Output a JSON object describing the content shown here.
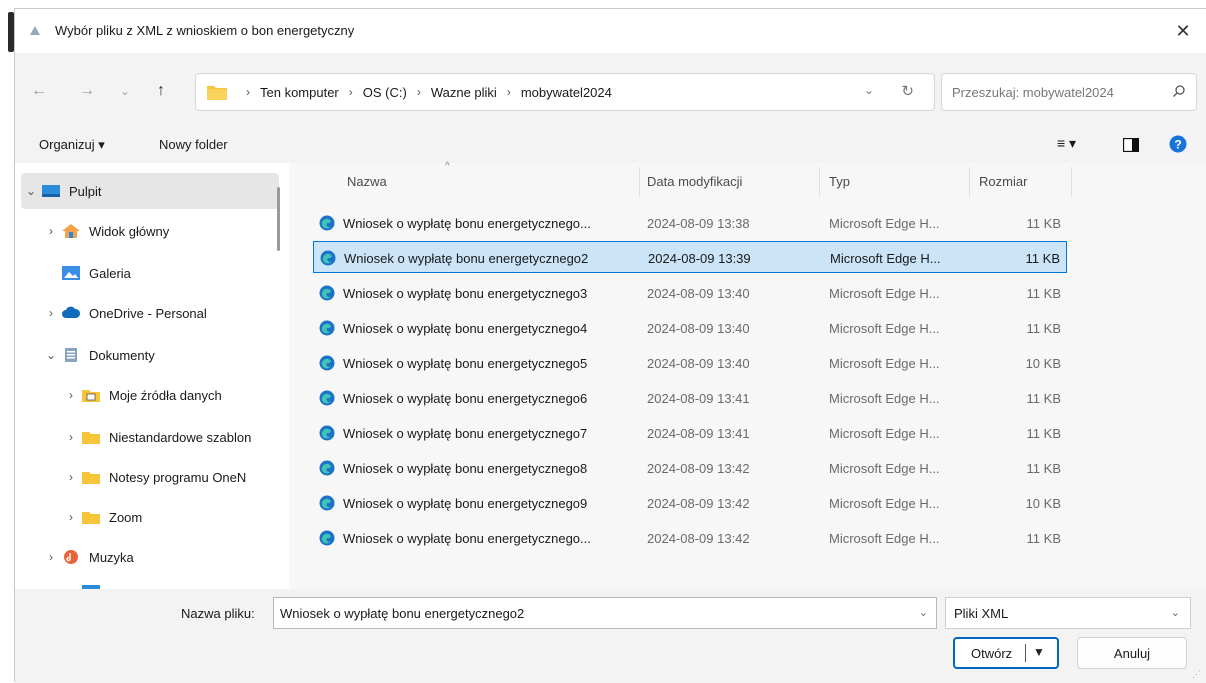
{
  "window": {
    "title": "Wybór pliku z XML z wnioskiem o bon energetyczny"
  },
  "address": {
    "crumbs": [
      "Ten komputer",
      "OS (C:)",
      "Wazne pliki",
      "mobywatel2024"
    ]
  },
  "search": {
    "placeholder": "Przeszukaj: mobywatel2024"
  },
  "toolbar": {
    "organize": "Organizuj ▾",
    "new_folder": "Nowy folder"
  },
  "sidebar": {
    "items": [
      {
        "label": "Pulpit",
        "icon": "desktop-icon",
        "chevron": "v",
        "selected": true
      },
      {
        "label": "Widok główny",
        "icon": "home-icon",
        "chevron": ">"
      },
      {
        "label": "Galeria",
        "icon": "gallery-icon",
        "chevron": ""
      },
      {
        "label": "OneDrive - Personal",
        "icon": "cloud-icon",
        "chevron": ">"
      },
      {
        "label": "Dokumenty",
        "icon": "documents-icon",
        "chevron": "v"
      },
      {
        "label": "Moje źródła danych",
        "icon": "datasource-folder-icon",
        "chevron": ">"
      },
      {
        "label": "Niestandardowe szablon",
        "icon": "folder-icon",
        "chevron": ">"
      },
      {
        "label": "Notesy programu OneN",
        "icon": "folder-icon",
        "chevron": ">"
      },
      {
        "label": "Zoom",
        "icon": "folder-icon",
        "chevron": ">"
      },
      {
        "label": "Muzyka",
        "icon": "music-icon",
        "chevron": ">"
      }
    ]
  },
  "columns": {
    "name": "Nazwa",
    "date": "Data modyfikacji",
    "type": "Typ",
    "size": "Rozmiar"
  },
  "files": [
    {
      "name": "Wniosek o wypłatę bonu energetycznego...",
      "date": "2024-08-09 13:38",
      "type": "Microsoft Edge H...",
      "size": "11 KB"
    },
    {
      "name": "Wniosek o wypłatę bonu energetycznego2",
      "date": "2024-08-09 13:39",
      "type": "Microsoft Edge H...",
      "size": "11 KB",
      "selected": true
    },
    {
      "name": "Wniosek o wypłatę bonu energetycznego3",
      "date": "2024-08-09 13:40",
      "type": "Microsoft Edge H...",
      "size": "11 KB"
    },
    {
      "name": "Wniosek o wypłatę bonu energetycznego4",
      "date": "2024-08-09 13:40",
      "type": "Microsoft Edge H...",
      "size": "11 KB"
    },
    {
      "name": "Wniosek o wypłatę bonu energetycznego5",
      "date": "2024-08-09 13:40",
      "type": "Microsoft Edge H...",
      "size": "10 KB"
    },
    {
      "name": "Wniosek o wypłatę bonu energetycznego6",
      "date": "2024-08-09 13:41",
      "type": "Microsoft Edge H...",
      "size": "11 KB"
    },
    {
      "name": "Wniosek o wypłatę bonu energetycznego7",
      "date": "2024-08-09 13:41",
      "type": "Microsoft Edge H...",
      "size": "11 KB"
    },
    {
      "name": "Wniosek o wypłatę bonu energetycznego8",
      "date": "2024-08-09 13:42",
      "type": "Microsoft Edge H...",
      "size": "11 KB"
    },
    {
      "name": "Wniosek o wypłatę bonu energetycznego9",
      "date": "2024-08-09 13:42",
      "type": "Microsoft Edge H...",
      "size": "10 KB"
    },
    {
      "name": "Wniosek o wypłatę bonu energetycznego...",
      "date": "2024-08-09 13:42",
      "type": "Microsoft Edge H...",
      "size": "11 KB"
    }
  ],
  "footer": {
    "filename_label": "Nazwa pliku:",
    "filename_value": "Wniosek o wypłatę bonu energetycznego2",
    "filetype_value": "Pliki XML",
    "open_label": "Otwórz",
    "cancel_label": "Anuluj"
  },
  "colors": {
    "accent": "#0067c0",
    "selection": "#cce4f7",
    "folder": "#f8c43a",
    "edge": "#1a73c9"
  }
}
